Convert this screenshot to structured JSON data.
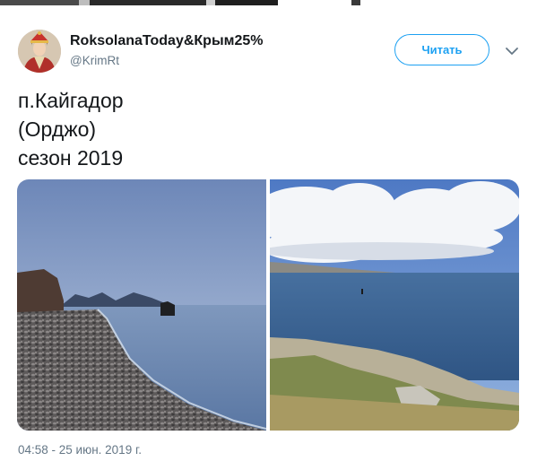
{
  "tweet": {
    "author_name": "RoksolanaToday&Крым25%",
    "author_handle": "@KrimRt",
    "follow_label": "Читать",
    "text_lines": [
      "п.Кайгадор",
      "(Орджо)",
      "сезон 2019"
    ],
    "timestamp": "04:58 - 25 июн. 2019 г.",
    "photos": [
      {
        "description_icon": "pebble-beach-photo"
      },
      {
        "description_icon": "sea-cliff-clouds-photo"
      }
    ]
  },
  "icons": {
    "avatar": "avatar-portrait",
    "menu": "chevron-down-icon"
  },
  "colors": {
    "accent": "#1da1f2",
    "text": "#14171a",
    "secondary": "#657786"
  }
}
